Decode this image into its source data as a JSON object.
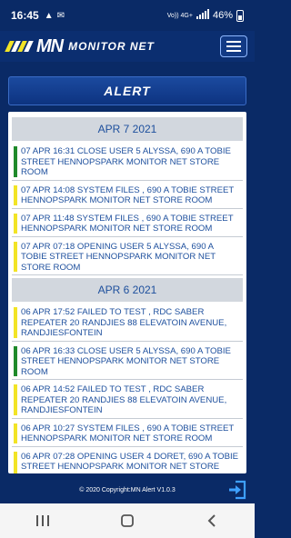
{
  "status": {
    "time": "16:45",
    "net1": "Vo)) 4G+",
    "net2": "LTE1 LTE2",
    "battery": "46%"
  },
  "header": {
    "logo_mark": "MN",
    "logo_text": "MONITOR NET",
    "stripe_colors": [
      "#f2e426",
      "#ffffff",
      "#f2e426",
      "#ffffff"
    ]
  },
  "page": {
    "title": "ALERT"
  },
  "colors": {
    "accent_green": "#1f8a2a",
    "accent_yellow": "#f2e426",
    "text_blue": "#1d4f9d",
    "background": "#0a2a66"
  },
  "groups": [
    {
      "date": "APR 7 2021",
      "entries": [
        {
          "status": "green",
          "text": "07 APR 16:31 CLOSE USER 5 ALYSSA, 690 A TOBIE STREET HENNOPSPARK MONITOR NET STORE ROOM"
        },
        {
          "status": "yellow",
          "text": "07 APR 14:08 SYSTEM FILES , 690 A TOBIE STREET HENNOPSPARK MONITOR NET STORE ROOM"
        },
        {
          "status": "yellow",
          "text": "07 APR 11:48 SYSTEM FILES , 690 A TOBIE STREET HENNOPSPARK MONITOR NET STORE ROOM"
        },
        {
          "status": "yellow",
          "text": "07 APR 07:18 OPENING USER 5 ALYSSA, 690 A TOBIE STREET HENNOPSPARK MONITOR NET STORE ROOM"
        }
      ]
    },
    {
      "date": "APR 6 2021",
      "entries": [
        {
          "status": "yellow",
          "text": "06 APR 17:52 FAILED TO TEST , RDC SABER REPEATER 20 RANDJIES 88 ELEVATOIN AVENUE, RANDJIESFONTEIN"
        },
        {
          "status": "green",
          "text": "06 APR 16:33 CLOSE USER 5 ALYSSA, 690 A TOBIE STREET HENNOPSPARK MONITOR NET STORE ROOM"
        },
        {
          "status": "yellow",
          "text": "06 APR 14:52 FAILED TO TEST , RDC SABER REPEATER 20 RANDJIES 88 ELEVATOIN AVENUE, RANDJIESFONTEIN"
        },
        {
          "status": "yellow",
          "text": "06 APR 10:27 SYSTEM FILES , 690 A TOBIE STREET HENNOPSPARK MONITOR NET STORE ROOM"
        },
        {
          "status": "yellow",
          "text": "06 APR 07:28 OPENING USER 4 DORET, 690 A TOBIE STREET HENNOPSPARK MONITOR NET STORE ROOM"
        }
      ]
    }
  ],
  "footer": {
    "copyright": "© 2020 Copyright:MN Alert V1.0.3"
  },
  "icons": {
    "logout": "logout-icon",
    "menu": "hamburger-menu-icon",
    "nav_recent": "recent-apps-icon",
    "nav_home": "home-icon",
    "nav_back": "back-icon"
  }
}
